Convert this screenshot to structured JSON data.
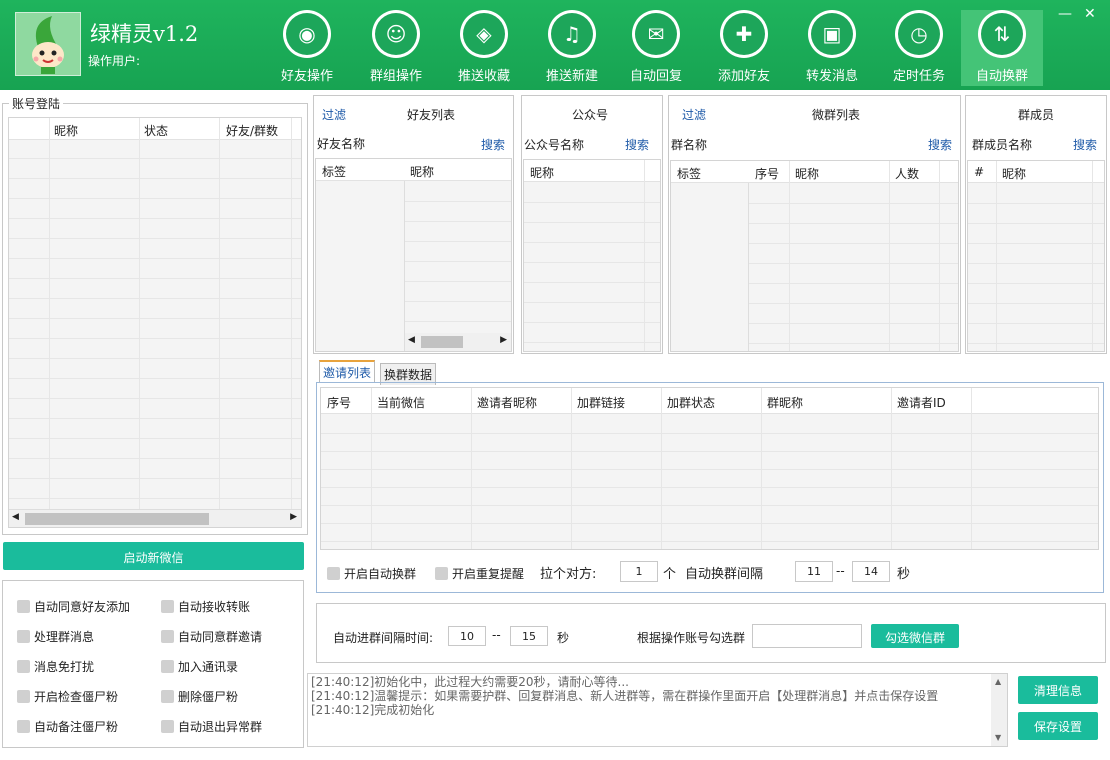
{
  "app": {
    "title": "绿精灵v1.2",
    "operator_label": "操作用户:"
  },
  "nav": [
    {
      "label": "好友操作",
      "icon": "person-circle-icon"
    },
    {
      "label": "群组操作",
      "icon": "group-person-icon"
    },
    {
      "label": "推送收藏",
      "icon": "tag-icon"
    },
    {
      "label": "推送新建",
      "icon": "bell-icon"
    },
    {
      "label": "自动回复",
      "icon": "chat-bubble-icon"
    },
    {
      "label": "添加好友",
      "icon": "add-person-icon"
    },
    {
      "label": "转发消息",
      "icon": "contact-card-icon"
    },
    {
      "label": "定时任务",
      "icon": "stopwatch-icon"
    },
    {
      "label": "自动换群",
      "icon": "phone-swap-icon"
    }
  ],
  "window": {
    "minimize": "—",
    "close": "✕"
  },
  "accounts": {
    "group_label": "账号登陆",
    "columns": [
      "昵称",
      "状态",
      "好友/群数"
    ],
    "start_button": "启动新微信"
  },
  "options": [
    "自动同意好友添加",
    "自动接收转账",
    "处理群消息",
    "自动同意群邀请",
    "消息免打扰",
    "加入通讯录",
    "开启检查僵尸粉",
    "删除僵尸粉",
    "自动备注僵尸粉",
    "自动退出异常群"
  ],
  "friends": {
    "filter": "过滤",
    "title": "好友列表",
    "search_label": "好友名称",
    "search_btn": "搜索",
    "columns": [
      "标签",
      "昵称"
    ]
  },
  "official": {
    "title": "公众号",
    "search_label": "公众号名称",
    "search_btn": "搜索",
    "columns": [
      "昵称"
    ]
  },
  "groups": {
    "filter": "过滤",
    "title": "微群列表",
    "search_label": "群名称",
    "search_btn": "搜索",
    "columns": [
      "标签",
      "序号",
      "昵称",
      "人数"
    ]
  },
  "members": {
    "title": "群成员",
    "search_label": "群成员名称",
    "search_btn": "搜索",
    "columns": [
      "#",
      "昵称"
    ]
  },
  "tabs": [
    "邀请列表",
    "换群数据"
  ],
  "invite": {
    "columns": [
      "序号",
      "当前微信",
      "邀请者昵称",
      "加群链接",
      "加群状态",
      "群昵称",
      "邀请者ID"
    ]
  },
  "swap": {
    "auto_swap": "开启自动换群",
    "repeat_remind": "开启重复提醒",
    "pull_label": "拉个对方:",
    "pull_value": "1",
    "pull_unit": "个",
    "interval_label": "自动换群间隔",
    "interval_from": "11",
    "sep": "--",
    "interval_to": "14",
    "unit": "秒"
  },
  "join": {
    "label": "自动进群间隔时间:",
    "from": "10",
    "sep": "--",
    "to": "15",
    "unit": "秒",
    "select_label": "根据操作账号勾选群",
    "select_btn": "勾选微信群"
  },
  "log": [
    "[21:40:12]初始化中，此过程大约需要20秒，请耐心等待...",
    "[21:40:12]温馨提示：如果需要护群、回复群消息、新人进群等，需在群操作里面开启【处理群消息】并点击保存设置",
    "[21:40:12]完成初始化"
  ],
  "actions": {
    "clear": "清理信息",
    "save": "保存设置"
  }
}
